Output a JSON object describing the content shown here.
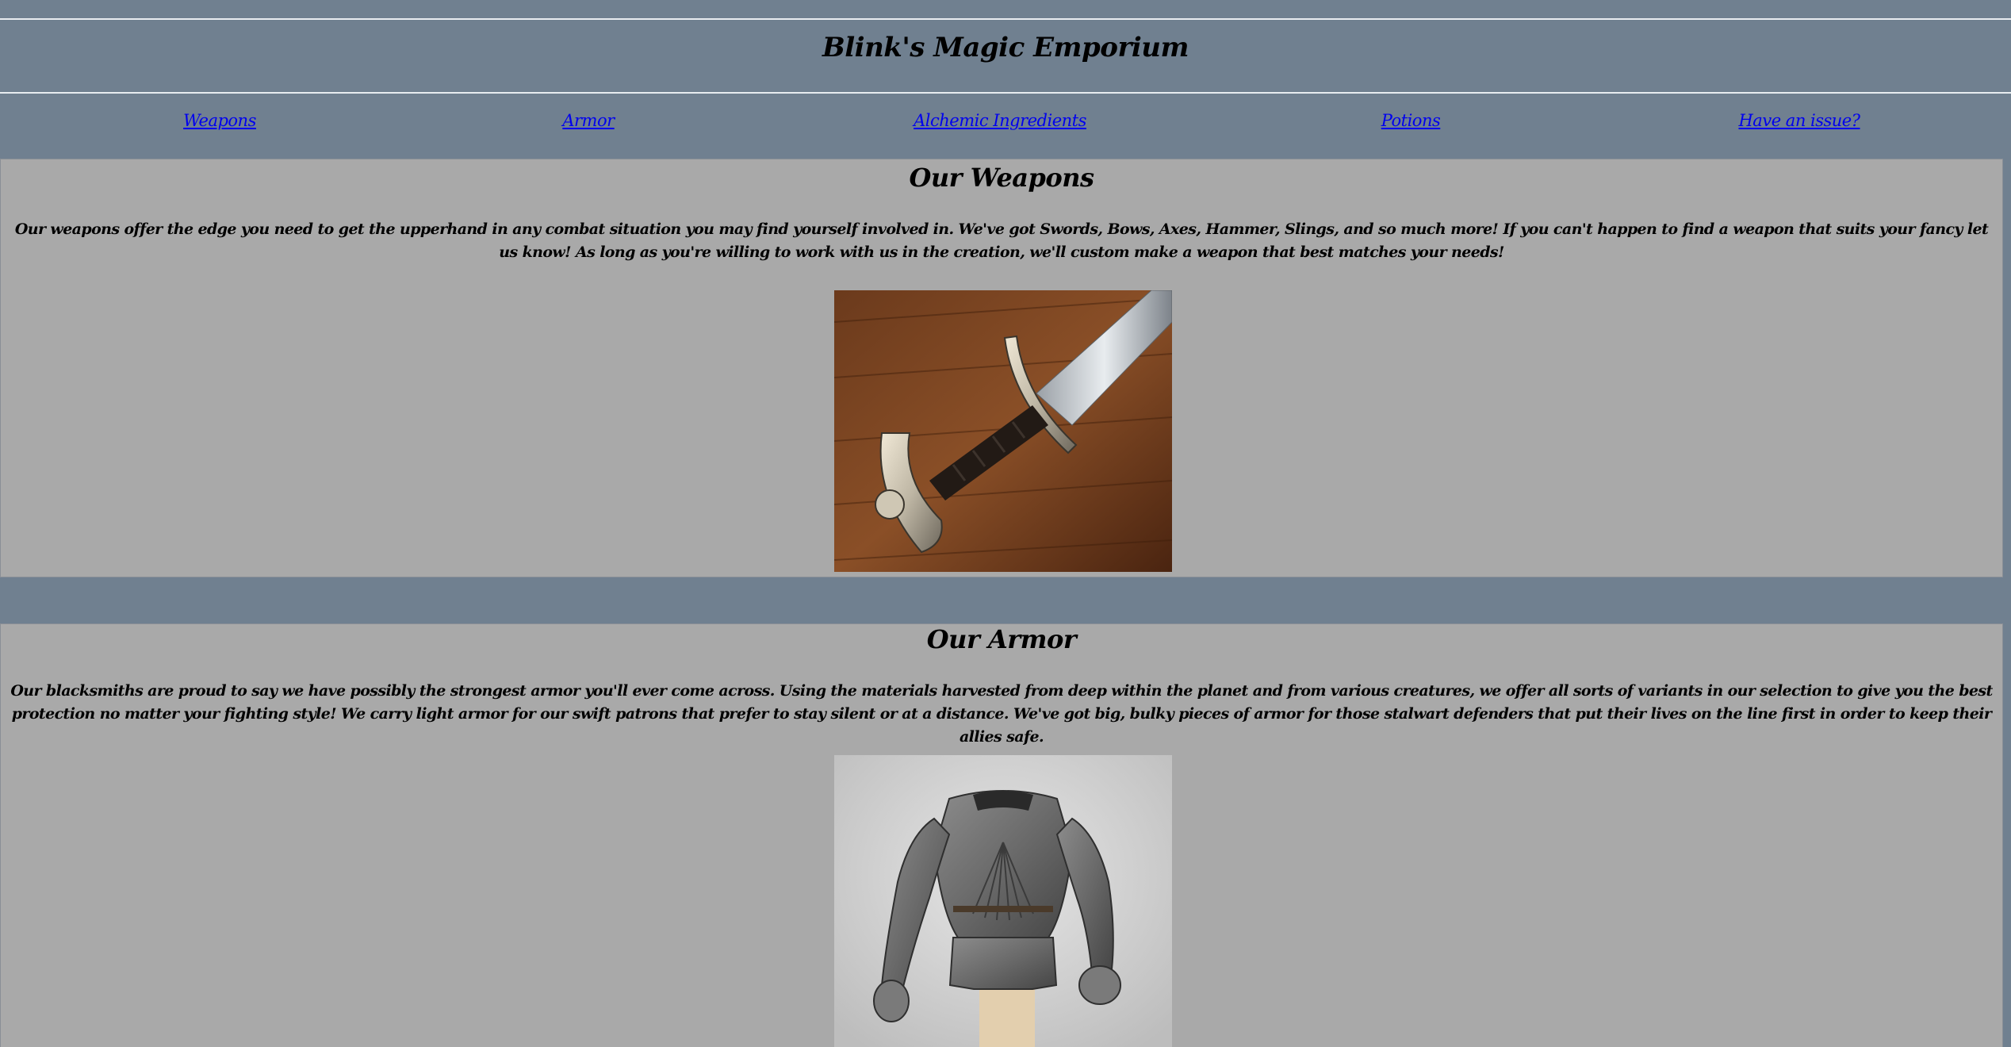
{
  "header": {
    "title": "Blink's Magic Emporium"
  },
  "nav": {
    "items": [
      {
        "label": "Weapons"
      },
      {
        "label": "Armor"
      },
      {
        "label": "Alchemic Ingredients"
      },
      {
        "label": "Potions"
      },
      {
        "label": "Have an issue?"
      }
    ]
  },
  "sections": {
    "weapons": {
      "heading": "Our Weapons",
      "text": "Our weapons offer the edge you need to get the upperhand in any combat situation you may find yourself involved in. We've got Swords, Bows, Axes, Hammer, Slings, and so much more! If you can't happen to find a weapon that suits your fancy let us know! As long as you're willing to work with us in the creation, we'll custom make a weapon that best matches your needs!",
      "image_icon": "sword-image"
    },
    "armor": {
      "heading": "Our Armor",
      "text": "Our blacksmiths are proud to say we have possibly the strongest armor you'll ever come across. Using the materials harvested from deep within the planet and from various creatures, we offer all sorts of variants in our selection to give you the best protection no matter your fighting style! We carry light armor for our swift patrons that prefer to stay silent or at a distance. We've got big, bulky pieces of armor for those stalwart defenders that put their lives on the line first in order to keep their allies safe.",
      "image_icon": "armor-image"
    }
  },
  "colors": {
    "background": "#708090",
    "section_background": "#a9a9a9",
    "link": "#0000ee"
  }
}
